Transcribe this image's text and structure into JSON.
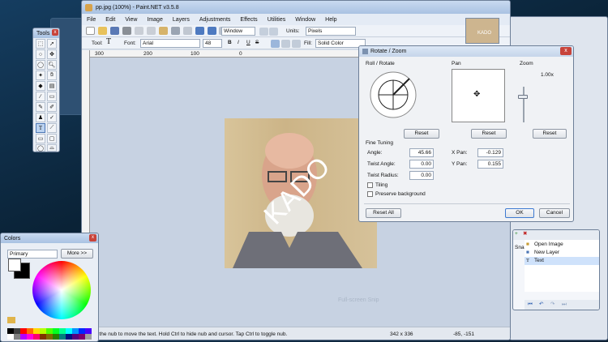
{
  "main": {
    "title": "pp.jpg (100%) - Paint.NET v3.5.8",
    "menu": [
      "File",
      "Edit",
      "View",
      "Image",
      "Layers",
      "Adjustments",
      "Effects",
      "Utilities",
      "Window",
      "Help"
    ],
    "zoom_select": "Window",
    "units_label": "Units:",
    "units_value": "Pixels",
    "tool_label": "Tool:",
    "font_label": "Font:",
    "font_value": "Arial",
    "size_value": "48",
    "fill_label": "Fill:",
    "fill_value": "Solid Color",
    "ruler_marks": [
      "300",
      "200",
      "100",
      "0"
    ],
    "thumb_text": "KADO",
    "image_text": "KADO",
    "watermark": "Full-screen Snip",
    "status_hint": "g the nub to move the text. Hold Ctrl to hide nub and cursor. Tap Ctrl to toggle nub.",
    "status_size": "342 x 336",
    "status_pos": "-85, -151"
  },
  "tools_win": {
    "title": "Tools"
  },
  "colors_win": {
    "title": "Colors",
    "mode": "Primary",
    "more_btn": "More >>",
    "palette": [
      "#000000",
      "#404040",
      "#ff0000",
      "#ff6a00",
      "#ffd800",
      "#b6ff00",
      "#4cff00",
      "#00ff21",
      "#00ff90",
      "#00ffff",
      "#0094ff",
      "#0026ff",
      "#4800ff",
      "#b200ff",
      "#ff00dc",
      "#ff006e",
      "#ffffff",
      "#808080"
    ]
  },
  "rotate_dlg": {
    "title": "Rotate / Zoom",
    "roll_label": "Roll / Rotate",
    "pan_label": "Pan",
    "zoom_label": "Zoom",
    "zoom_value": "1.00x",
    "reset": "Reset",
    "fine_label": "Fine Tuning",
    "angle_label": "Angle:",
    "angle_value": "45.66",
    "twist_angle_label": "Twist Angle:",
    "twist_angle_value": "0.00",
    "twist_radius_label": "Twist Radius:",
    "twist_radius_value": "0.00",
    "xpan_label": "X Pan:",
    "xpan_value": "-0.129",
    "ypan_label": "Y Pan:",
    "ypan_value": "0.155",
    "tiling_label": "Tiling",
    "preserve_label": "Preserve background",
    "reset_all": "Reset All",
    "ok": "OK",
    "cancel": "Cancel"
  },
  "history_win": {
    "items": [
      "Open Image",
      "New Layer",
      "Text"
    ],
    "side_label": "Sna"
  }
}
